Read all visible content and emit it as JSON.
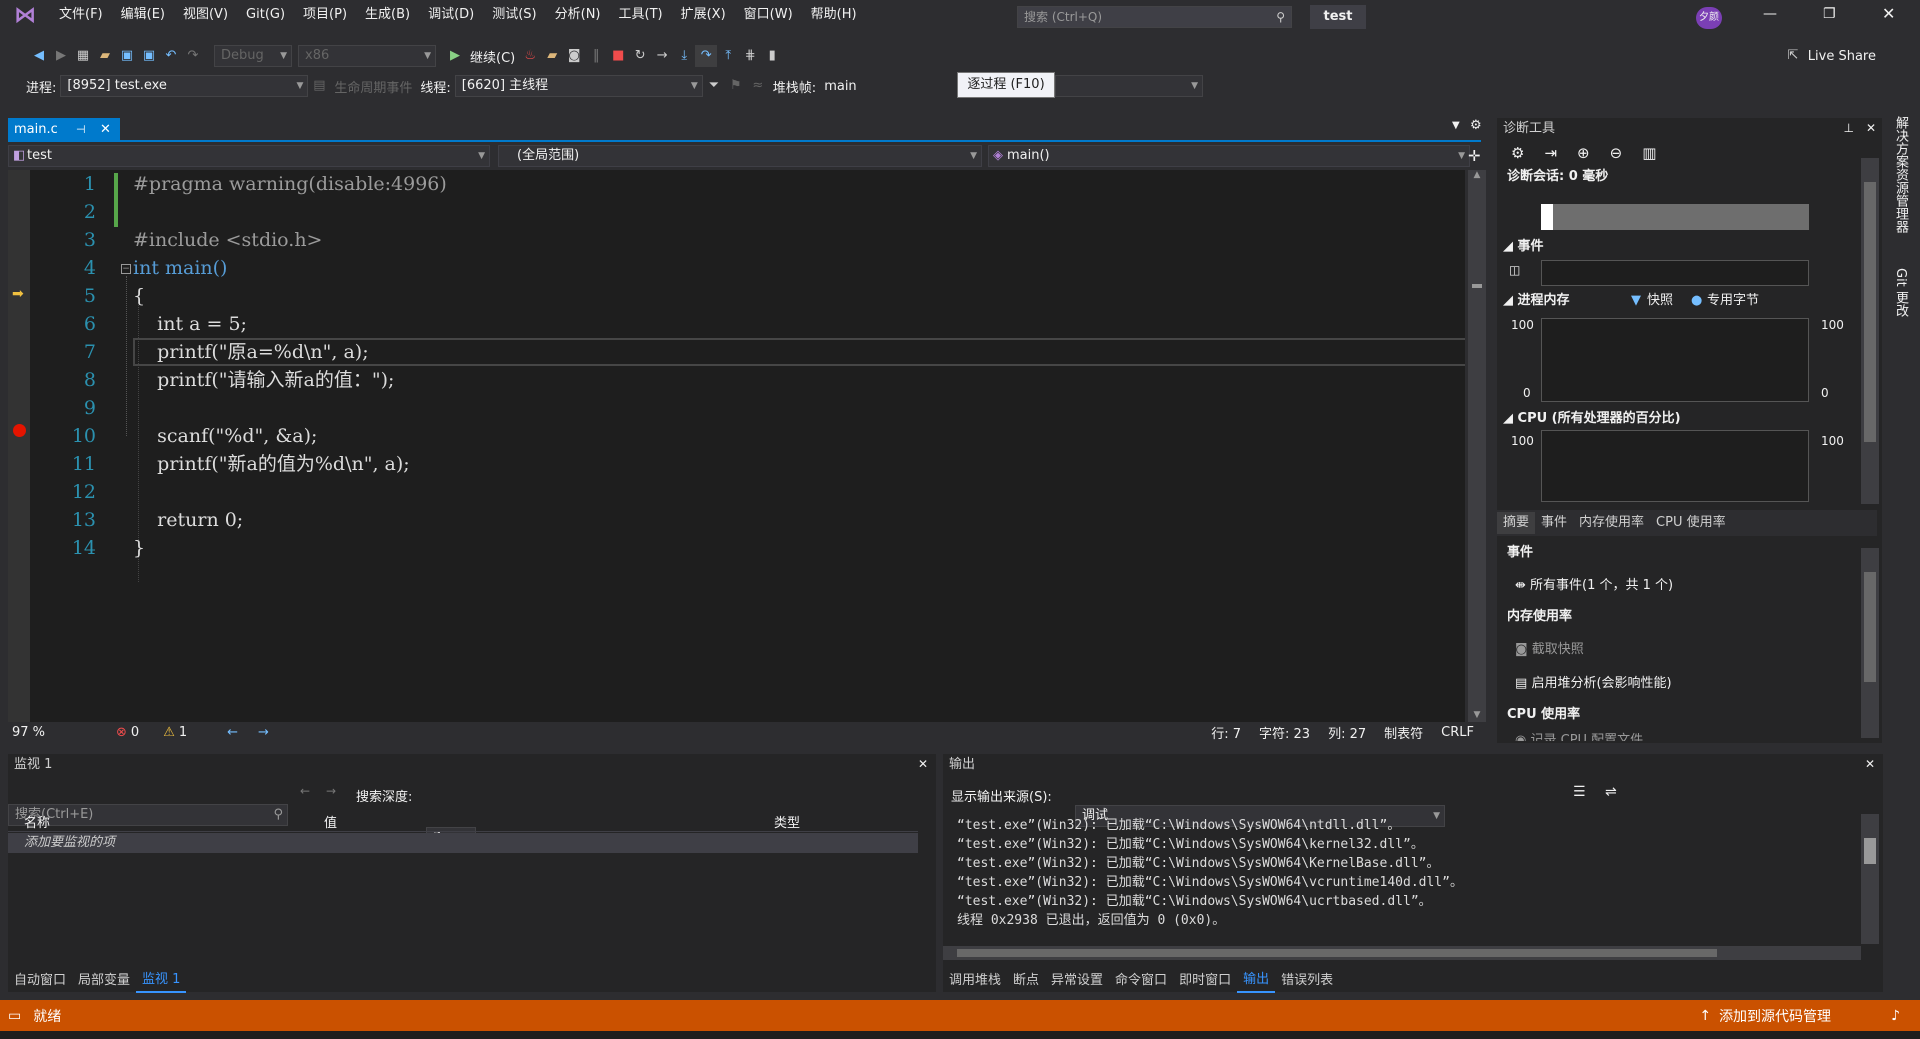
{
  "titlebar": {
    "menu": [
      "文件(F)",
      "编辑(E)",
      "视图(V)",
      "Git(G)",
      "项目(P)",
      "生成(B)",
      "调试(D)",
      "测试(S)",
      "分析(N)",
      "工具(T)",
      "扩展(X)",
      "窗口(W)",
      "帮助(H)"
    ],
    "search_placeholder": "搜索 (Ctrl+Q)",
    "solution_name": "test",
    "user_initials": "夕颜",
    "live_share": "Live Share"
  },
  "toolbar": {
    "config": "Debug",
    "platform": "x86",
    "continue_label": "继续(C)",
    "process_label": "进程:",
    "process_value": "[8952] test.exe",
    "lifecycle_label": "生命周期事件",
    "thread_label": "线程:",
    "thread_value": "[6620] 主线程",
    "stackframe_label": "堆栈帧:",
    "stackframe_value": "main",
    "tooltip": "逐过程 (F10)"
  },
  "editor": {
    "tab": "main.c",
    "nav_project": "test",
    "nav_scope": "(全局范围)",
    "nav_function": "main()",
    "zoom": "97 %",
    "errors": "0",
    "warnings": "1",
    "status": {
      "line": "行: 7",
      "char": "字符: 23",
      "col": "列: 27",
      "tab": "制表符",
      "eol": "CRLF"
    },
    "lines": [
      {
        "n": "1",
        "text": "#pragma warning(disable:4996)"
      },
      {
        "n": "2",
        "text": ""
      },
      {
        "n": "3",
        "text": "#include <stdio.h>"
      },
      {
        "n": "4",
        "text": "int main()"
      },
      {
        "n": "5",
        "text": "{"
      },
      {
        "n": "6",
        "text": "    int a = 5;"
      },
      {
        "n": "7",
        "text": "    printf(\"原a=%d\\n\", a);"
      },
      {
        "n": "8",
        "text": "    printf(\"请输入新a的值：\");"
      },
      {
        "n": "9",
        "text": ""
      },
      {
        "n": "10",
        "text": "    scanf(\"%d\", &a);"
      },
      {
        "n": "11",
        "text": "    printf(\"新a的值为%d\\n\", a);"
      },
      {
        "n": "12",
        "text": ""
      },
      {
        "n": "13",
        "text": "    return 0;"
      },
      {
        "n": "14",
        "text": "}"
      }
    ]
  },
  "diag": {
    "title": "诊断工具",
    "session": "诊断会话: 0 毫秒",
    "events": "事件",
    "process_memory": "进程内存",
    "snapshot": "快照",
    "private_bytes": "专用字节",
    "mem_max": "100",
    "mem_min": "0",
    "cpu": "CPU (所有处理器的百分比)",
    "cpu_max": "100",
    "tabs": [
      "摘要",
      "事件",
      "内存使用率",
      "CPU 使用率"
    ],
    "sum_events": "事件",
    "all_events": "所有事件(1 个，共 1 个)",
    "mem_usage": "内存使用率",
    "take_snapshot": "截取快照",
    "heap_profile": "启用堆分析(会影响性能)",
    "cpu_usage": "CPU 使用率",
    "record_cpu": "记录 CPU 配置文件"
  },
  "rail": {
    "solution_explorer": "解决方案资源管理器",
    "git": "Git 更改"
  },
  "watch": {
    "title": "监视 1",
    "search_placeholder": "搜索(Ctrl+E)",
    "depth_label": "搜索深度:",
    "depth_value": "3",
    "cols": [
      "名称",
      "值",
      "类型"
    ],
    "add_item": "添加要监视的项",
    "tabs": [
      "自动窗口",
      "局部变量",
      "监视 1"
    ]
  },
  "output": {
    "title": "输出",
    "source_label": "显示输出来源(S):",
    "source_value": "调试",
    "lines": [
      "“test.exe”(Win32): 已加载“C:\\Windows\\SysWOW64\\ntdll.dll”。",
      "“test.exe”(Win32): 已加载“C:\\Windows\\SysWOW64\\kernel32.dll”。",
      "“test.exe”(Win32): 已加载“C:\\Windows\\SysWOW64\\KernelBase.dll”。",
      "“test.exe”(Win32): 已加载“C:\\Windows\\SysWOW64\\vcruntime140d.dll”。",
      "“test.exe”(Win32): 已加载“C:\\Windows\\SysWOW64\\ucrtbased.dll”。",
      "线程 0x2938 已退出，返回值为 0 (0x0)。"
    ],
    "tabs": [
      "调用堆栈",
      "断点",
      "异常设置",
      "命令窗口",
      "即时窗口",
      "输出",
      "错误列表"
    ]
  },
  "status": {
    "ready": "就绪",
    "add_source": "添加到源代码管理"
  }
}
